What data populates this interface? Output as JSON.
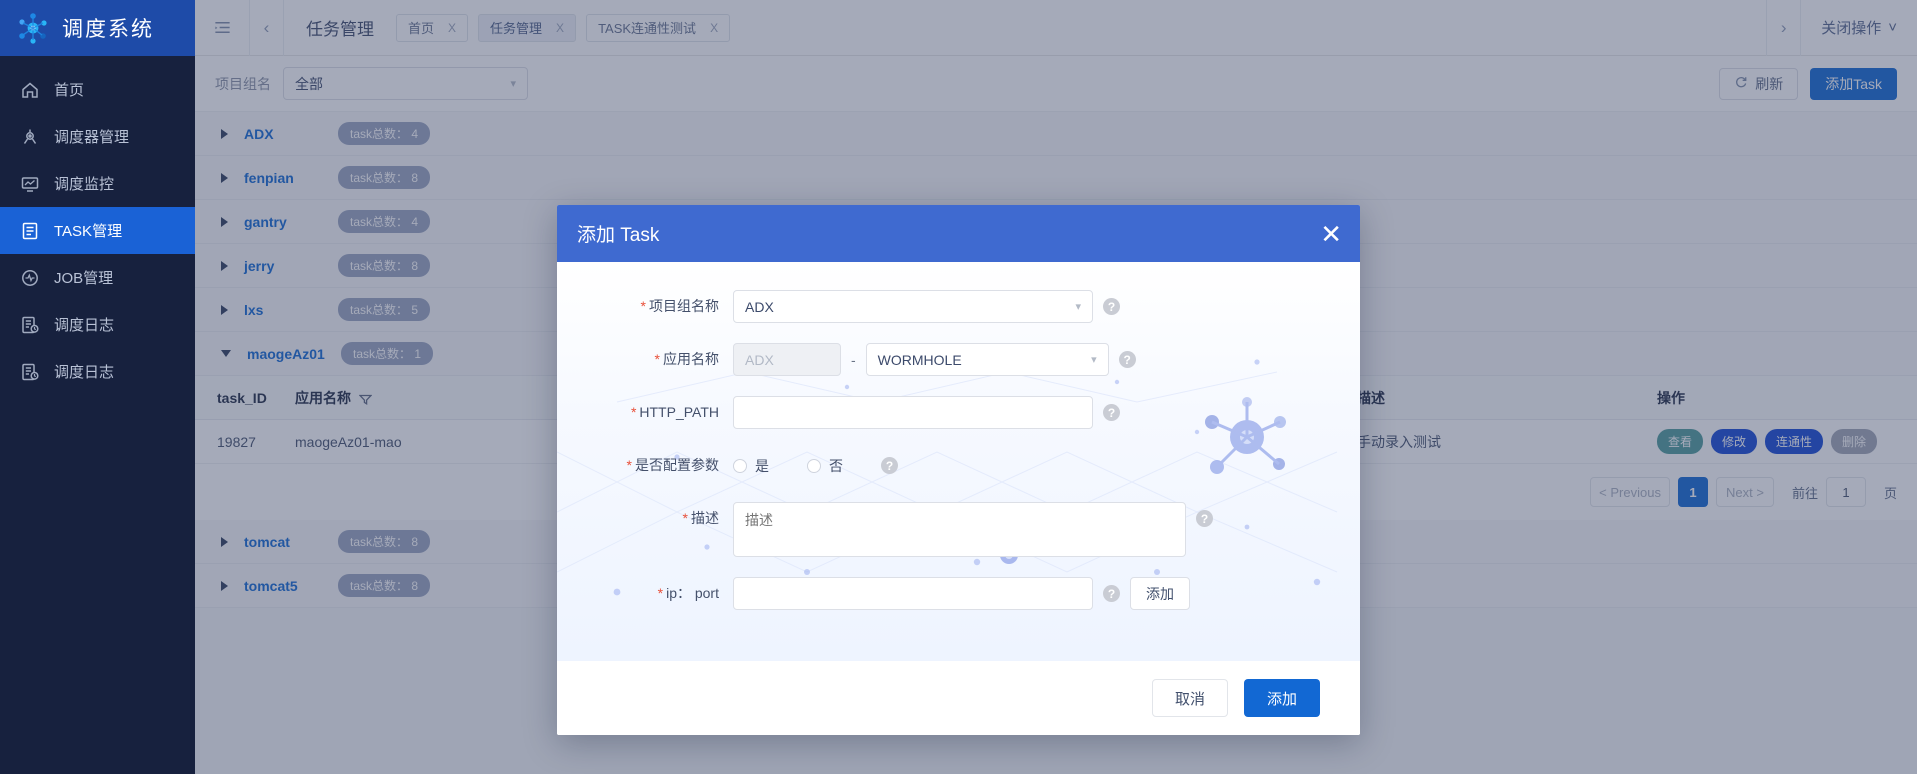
{
  "sidebar": {
    "brand": "调度系统",
    "items": [
      {
        "label": "首页",
        "icon": "home-icon",
        "active": false
      },
      {
        "label": "调度器管理",
        "icon": "scheduler-icon",
        "active": false
      },
      {
        "label": "调度监控",
        "icon": "monitor-icon",
        "active": false
      },
      {
        "label": "TASK管理",
        "icon": "task-icon",
        "active": true
      },
      {
        "label": "JOB管理",
        "icon": "job-icon",
        "active": false
      },
      {
        "label": "调度日志",
        "icon": "log-icon",
        "active": false
      },
      {
        "label": "调度日志",
        "icon": "log-icon",
        "active": false
      }
    ]
  },
  "topbar": {
    "menu_icon": "menu-collapse-icon",
    "prev_icon": "chevron-left-icon",
    "next_icon": "chevron-right-icon",
    "page_name": "任务管理",
    "tabs": [
      {
        "label": "首页",
        "close": "X",
        "active": false
      },
      {
        "label": "任务管理",
        "close": "X",
        "active": true
      },
      {
        "label": "TASK连通性测试",
        "close": "X",
        "active": false
      }
    ],
    "close_op": "关闭操作",
    "close_op_chevron": "˅"
  },
  "toolbar": {
    "filter_label": "项目组名",
    "filter_value": "全部",
    "refresh_label": "刷新",
    "add_task_label": "添加Task"
  },
  "groups": [
    {
      "name": "ADX",
      "badge": "task总数： 4",
      "expanded": false
    },
    {
      "name": "fenpian",
      "badge": "task总数： 8",
      "expanded": false
    },
    {
      "name": "gantry",
      "badge": "task总数： 4",
      "expanded": false
    },
    {
      "name": "jerry",
      "badge": "task总数： 8",
      "expanded": false
    },
    {
      "name": "lxs",
      "badge": "task总数： 5",
      "expanded": false
    },
    {
      "name": "maogeAz01",
      "badge": "task总数： 1",
      "expanded": true
    }
  ],
  "groups_after": [
    {
      "name": "tomcat",
      "badge": "task总数： 8",
      "expanded": false
    },
    {
      "name": "tomcat5",
      "badge": "task总数： 8",
      "expanded": false
    }
  ],
  "table": {
    "headers": {
      "id": "task_ID",
      "app": "应用名称",
      "desc": "描述",
      "ops": "操作"
    },
    "rows": [
      {
        "id": "19827",
        "app": "maogeAz01-mao",
        "desc": "手动录入测试",
        "ops": [
          "查看",
          "修改",
          "连通性",
          "删除"
        ]
      }
    ]
  },
  "pagination": {
    "previous": "< Previous",
    "current": "1",
    "next": "Next >",
    "goto_label": "前往",
    "goto_value": "1",
    "page_unit": "页"
  },
  "modal": {
    "title": "添加 Task",
    "close_icon": "close-icon",
    "fields": {
      "project_group": {
        "label": "项目组名称",
        "value": "ADX",
        "required": "*"
      },
      "app_name": {
        "label": "应用名称",
        "prefix_value": "ADX",
        "separator": "-",
        "suffix_value": "WORMHOLE",
        "required": "*"
      },
      "http_path": {
        "label": "HTTP_PATH",
        "value": "",
        "required": "*"
      },
      "config_param": {
        "label": "是否配置参数",
        "required": "*",
        "yes": "是",
        "no": "否"
      },
      "description": {
        "label": "描述",
        "value": "",
        "placeholder": "描述",
        "required": "*"
      },
      "ip_port": {
        "label": "ip： port",
        "value": "",
        "required": "*",
        "add_button": "添加"
      }
    },
    "footer": {
      "cancel": "取消",
      "confirm": "添加"
    },
    "help_icon": "question-mark-icon"
  },
  "colors": {
    "brand_blue": "#1e4ba8",
    "sidebar_dark": "#17213e",
    "primary": "#1268d3",
    "modal_header": "#3f6ad0",
    "accent_link": "#1268d3"
  }
}
